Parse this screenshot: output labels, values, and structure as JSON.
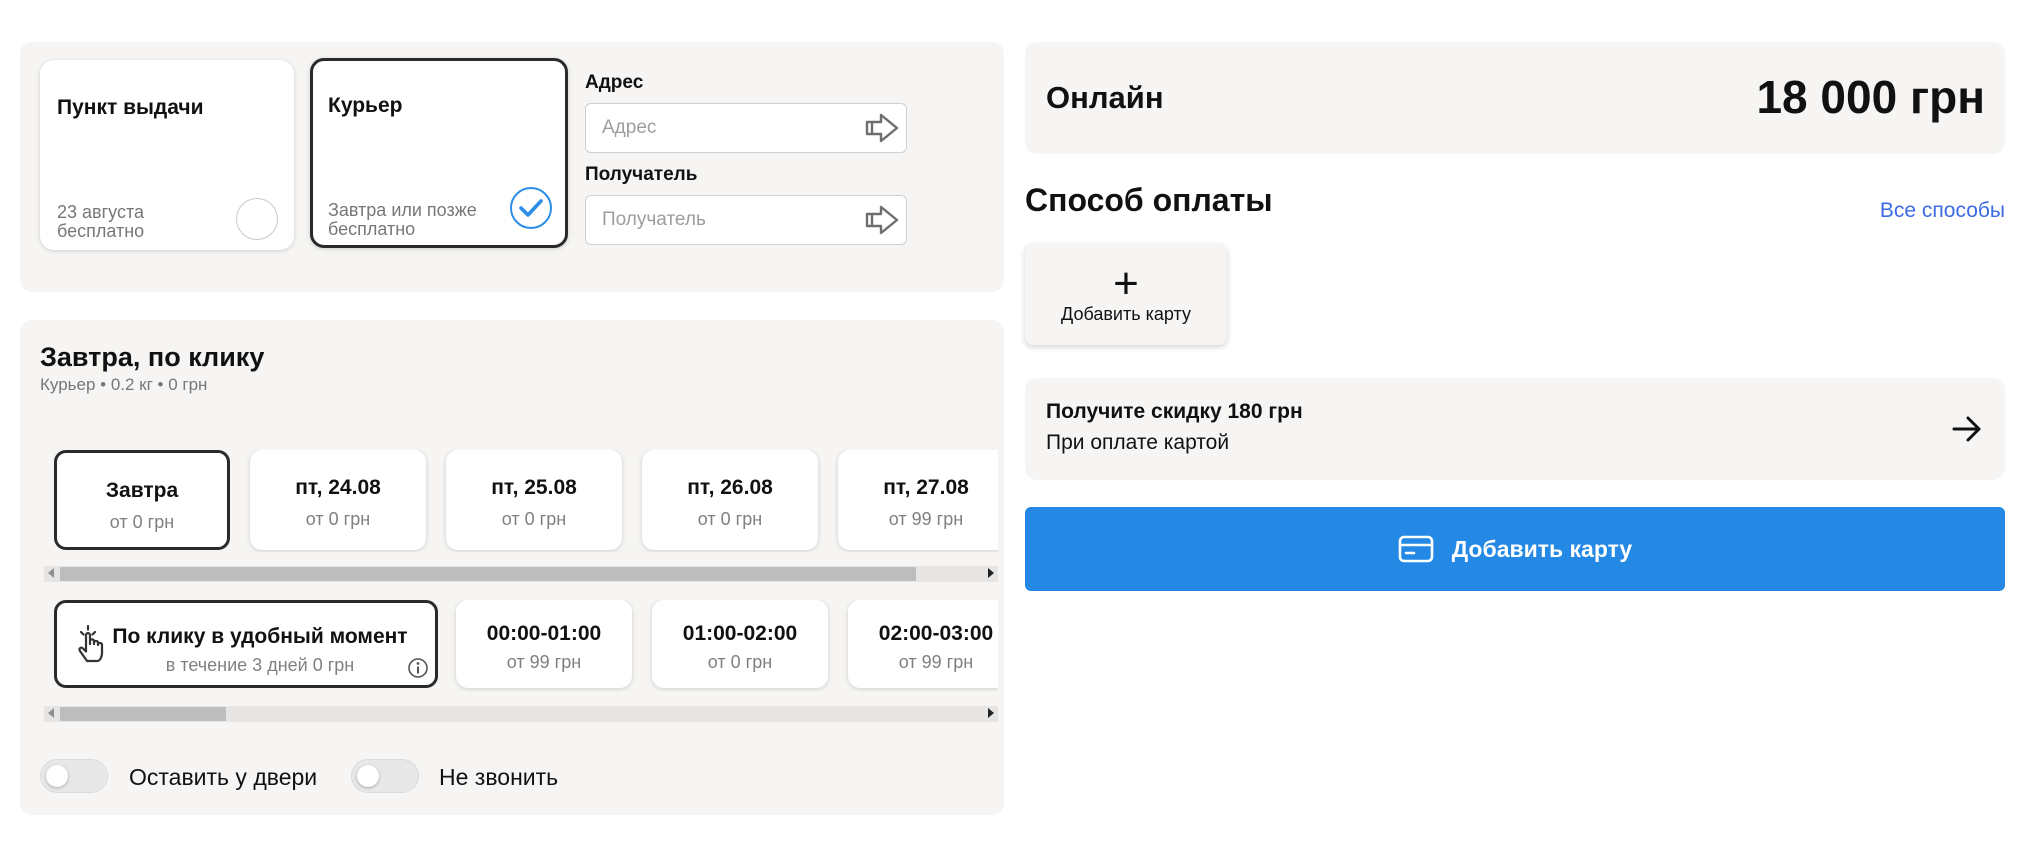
{
  "delivery": {
    "pickup": {
      "title": "Пункт выдачи",
      "line1": "23 августа",
      "line2": "бесплатно"
    },
    "courier": {
      "title": "Курьер",
      "line1": "Завтра или позже",
      "line2": "бесплатно"
    },
    "address": {
      "label": "Адрес",
      "placeholder": "Адрес"
    },
    "recipient": {
      "label": "Получатель",
      "placeholder": "Получатель"
    }
  },
  "schedule": {
    "title": "Завтра, по клику",
    "meta": "Курьер • 0.2 кг • 0 грн",
    "dates": [
      {
        "label": "Завтра",
        "price": "от 0 грн"
      },
      {
        "label": "пт, 24.08",
        "price": "от 0 грн"
      },
      {
        "label": "пт, 25.08",
        "price": "от 0 грн"
      },
      {
        "label": "пт, 26.08",
        "price": "от 0 грн"
      },
      {
        "label": "пт, 27.08",
        "price": "от 99 грн"
      }
    ],
    "slots": [
      {
        "label": "По клику в удобный момент",
        "sub": "в течение 3 дней 0 грн"
      },
      {
        "label": "00:00-01:00",
        "sub": "от 99 грн"
      },
      {
        "label": "01:00-02:00",
        "sub": "от 0 грн"
      },
      {
        "label": "02:00-03:00",
        "sub": "от 99 грн"
      }
    ],
    "toggles": {
      "leave_at_door": "Оставить у двери",
      "no_call": "Не звонить"
    }
  },
  "payment": {
    "total_label": "Онлайн",
    "total_amount": "18 000 грн",
    "section_title": "Способ оплаты",
    "all_methods": "Все способы",
    "add_card_tile": "Добавить карту",
    "promo_title": "Получите скидку 180 грн",
    "promo_sub": "При оплате картой",
    "cta_label": "Добавить карту"
  },
  "colors": {
    "accent": "#2389e4",
    "link": "#3d6ae6",
    "check": "#2b8ee6",
    "panel_bg": "#f6f5f3"
  },
  "icons": [
    "checkmark-icon",
    "arrow-right-icon",
    "tap-hand-icon",
    "info-icon",
    "plus-icon",
    "credit-card-icon"
  ]
}
